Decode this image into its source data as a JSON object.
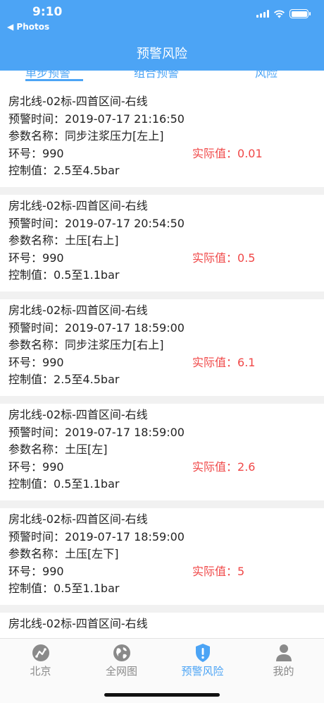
{
  "status": {
    "time": "9:10",
    "back_label": "◀ Photos"
  },
  "header": {
    "title": "预警风险"
  },
  "tabs": [
    {
      "label": "单步预警"
    },
    {
      "label": "组合预警"
    },
    {
      "label": "风险"
    }
  ],
  "cards": [
    {
      "project": "房北线-02标-四首区间-右线",
      "time_label": "预警时间：",
      "time": "2019-07-17 21:16:50",
      "param_label": "参数名称：",
      "param": "同步注浆压力[左上]",
      "ring_label": "环号：",
      "ring": "990",
      "actual_label": "实际值：",
      "actual": "0.01",
      "control_label": "控制值：",
      "control": "2.5至4.5bar"
    },
    {
      "project": "房北线-02标-四首区间-右线",
      "time_label": "预警时间：",
      "time": "2019-07-17 20:54:50",
      "param_label": "参数名称：",
      "param": "土压[右上]",
      "ring_label": "环号：",
      "ring": "990",
      "actual_label": "实际值：",
      "actual": "0.5",
      "control_label": "控制值：",
      "control": "0.5至1.1bar"
    },
    {
      "project": "房北线-02标-四首区间-右线",
      "time_label": "预警时间：",
      "time": "2019-07-17 18:59:00",
      "param_label": "参数名称：",
      "param": "同步注浆压力[右上]",
      "ring_label": "环号：",
      "ring": "990",
      "actual_label": "实际值：",
      "actual": "6.1",
      "control_label": "控制值：",
      "control": "2.5至4.5bar"
    },
    {
      "project": "房北线-02标-四首区间-右线",
      "time_label": "预警时间：",
      "time": "2019-07-17 18:59:00",
      "param_label": "参数名称：",
      "param": "土压[左]",
      "ring_label": "环号：",
      "ring": "990",
      "actual_label": "实际值：",
      "actual": "2.6",
      "control_label": "控制值：",
      "control": "0.5至1.1bar"
    },
    {
      "project": "房北线-02标-四首区间-右线",
      "time_label": "预警时间：",
      "time": "2019-07-17 18:59:00",
      "param_label": "参数名称：",
      "param": "土压[左下]",
      "ring_label": "环号：",
      "ring": "990",
      "actual_label": "实际值：",
      "actual": "5",
      "control_label": "控制值：",
      "control": "0.5至1.1bar"
    },
    {
      "project": "房北线-02标-四首区间-右线"
    }
  ],
  "tabbar": [
    {
      "label": "北京",
      "icon": "route-icon"
    },
    {
      "label": "全网图",
      "icon": "globe-icon"
    },
    {
      "label": "预警风险",
      "icon": "shield-alert-icon",
      "active": true
    },
    {
      "label": "我的",
      "icon": "user-icon"
    }
  ],
  "colors": {
    "primary": "#4ca4f5",
    "alert": "#f04747",
    "background": "#f1f1f1"
  }
}
